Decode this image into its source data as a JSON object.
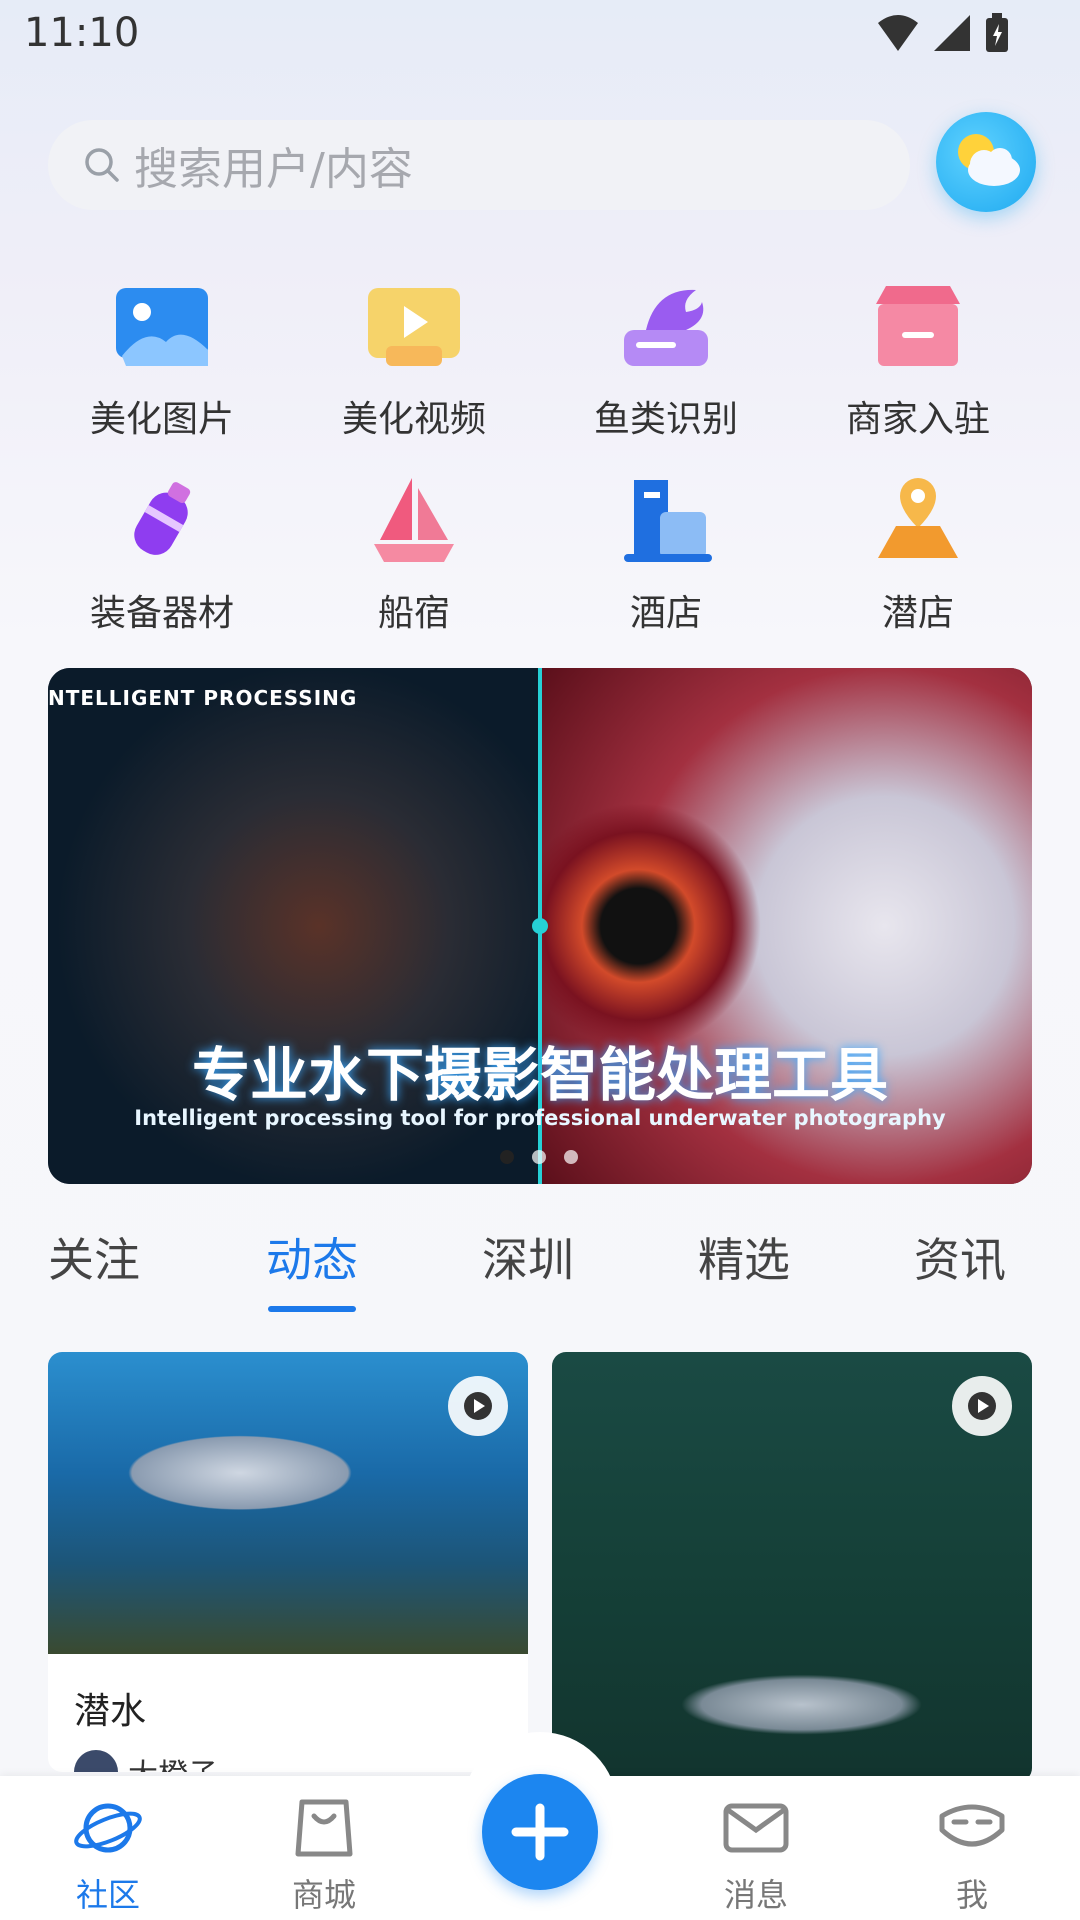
{
  "status": {
    "time": "11:10"
  },
  "search": {
    "placeholder": "搜索用户/内容"
  },
  "grid": [
    {
      "label": "美化图片",
      "icon": "photo-icon"
    },
    {
      "label": "美化视频",
      "icon": "video-icon"
    },
    {
      "label": "鱼类识别",
      "icon": "fish-id-icon"
    },
    {
      "label": "商家入驻",
      "icon": "store-icon"
    },
    {
      "label": "装备器材",
      "icon": "diving-gear-icon"
    },
    {
      "label": "船宿",
      "icon": "boat-icon"
    },
    {
      "label": "酒店",
      "icon": "hotel-icon"
    },
    {
      "label": "潜店",
      "icon": "dive-shop-icon"
    }
  ],
  "banner": {
    "top_text": "NTELLIGENT PROCESSING",
    "title": "专业水下摄影智能处理工具",
    "subtitle": "Intelligent processing tool for professional underwater photography",
    "active_dot": 0,
    "dot_count": 3
  },
  "tabs": [
    {
      "label": "关注",
      "active": false
    },
    {
      "label": "动态",
      "active": true
    },
    {
      "label": "深圳",
      "active": false
    },
    {
      "label": "精选",
      "active": false
    },
    {
      "label": "资讯",
      "active": false
    }
  ],
  "feed": [
    {
      "title": "潜水",
      "username": "大橙子",
      "has_video": true
    },
    {
      "has_video": true
    }
  ],
  "bottom_nav": [
    {
      "label": "社区",
      "active": true,
      "icon": "planet-icon"
    },
    {
      "label": "商城",
      "active": false,
      "icon": "shopping-bag-icon"
    },
    {
      "label": "消息",
      "active": false,
      "icon": "mail-icon"
    },
    {
      "label": "我",
      "active": false,
      "icon": "profile-mask-icon"
    }
  ],
  "colors": {
    "accent": "#1c79ea",
    "fab": "#1c86f0"
  }
}
